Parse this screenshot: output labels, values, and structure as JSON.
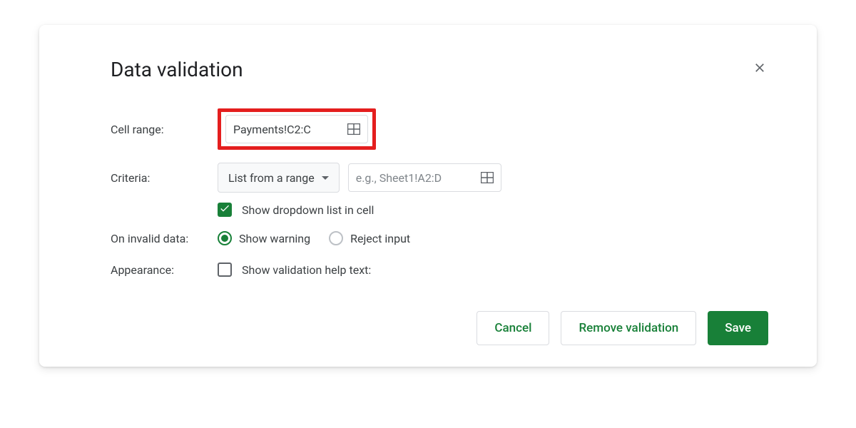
{
  "dialog": {
    "title": "Data validation"
  },
  "cellRange": {
    "label": "Cell range:",
    "value": "Payments!C2:C"
  },
  "criteria": {
    "label": "Criteria:",
    "dropdown": "List from a range",
    "rangeInputPlaceholder": "e.g., Sheet1!A2:D",
    "showDropdownLabel": "Show dropdown list in cell",
    "showDropdownChecked": true
  },
  "invalidData": {
    "label": "On invalid data:",
    "options": {
      "warning": "Show warning",
      "reject": "Reject input"
    },
    "selected": "warning"
  },
  "appearance": {
    "label": "Appearance:",
    "helpTextLabel": "Show validation help text:",
    "helpTextChecked": false
  },
  "buttons": {
    "cancel": "Cancel",
    "remove": "Remove validation",
    "save": "Save"
  }
}
